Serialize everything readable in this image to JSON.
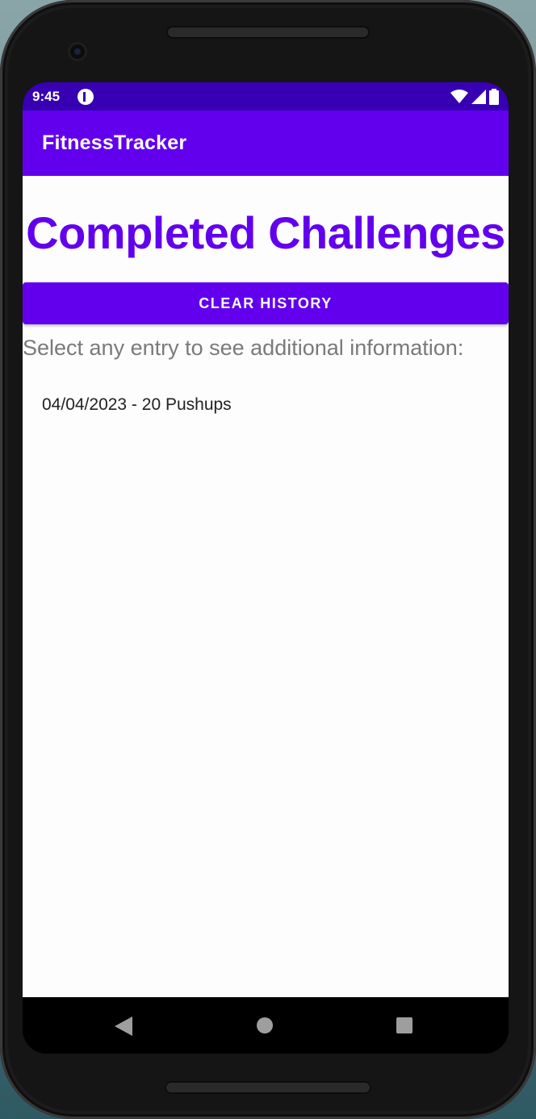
{
  "status_bar": {
    "time": "9:45",
    "icons": [
      "notification-app-icon",
      "wifi-icon",
      "signal-icon",
      "battery-icon"
    ]
  },
  "app_bar": {
    "title": "FitnessTracker"
  },
  "main": {
    "heading": "Completed Challenges",
    "clear_button_label": "CLEAR HISTORY",
    "hint": "Select any entry to see additional information:",
    "entries": [
      {
        "label": "04/04/2023 - 20 Pushups"
      }
    ]
  },
  "nav_bar": {
    "icons": [
      "back-icon",
      "home-icon",
      "recent-apps-icon"
    ]
  },
  "colors": {
    "primary": "#6200ee",
    "primary_dark": "#3700b3",
    "hint_text": "#7a7a7a"
  }
}
